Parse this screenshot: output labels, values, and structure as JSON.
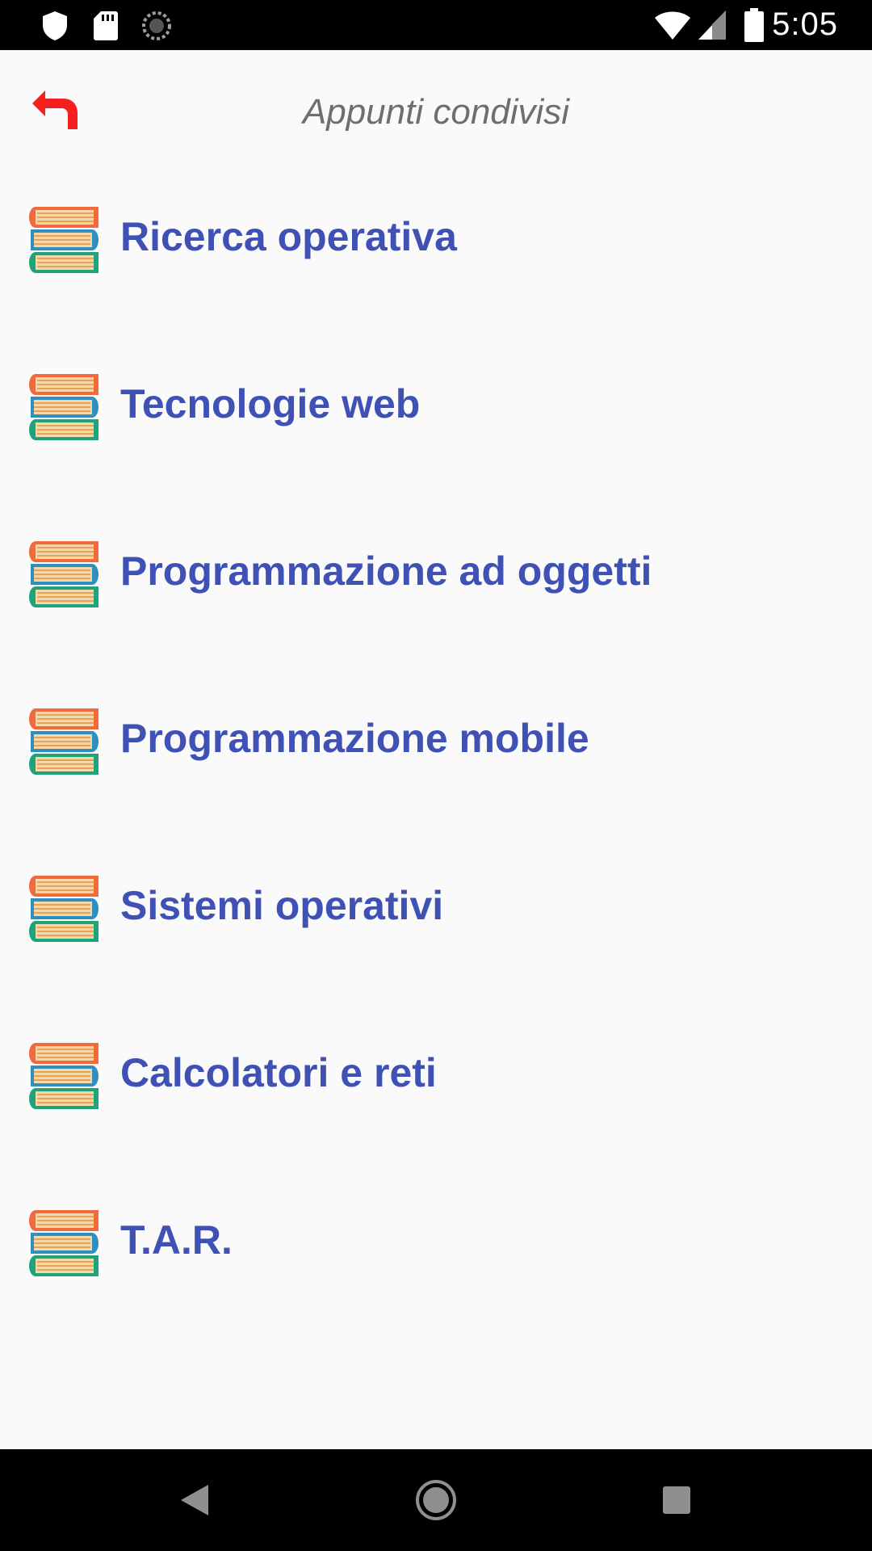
{
  "status_bar": {
    "time": "5:05",
    "left_icons": [
      "shield-icon",
      "sd-card-icon",
      "sync-icon"
    ],
    "right_icons": [
      "wifi-icon",
      "cell-signal-icon",
      "battery-icon"
    ]
  },
  "header": {
    "title": "Appunti condivisi",
    "back_icon": "back-arrow-icon",
    "back_color": "#f41f1f"
  },
  "colors": {
    "item_text": "#3f51b5",
    "title_text": "#6e6e6e",
    "background": "#fafafa"
  },
  "courses": [
    {
      "label": "Ricerca operativa",
      "icon": "books-icon"
    },
    {
      "label": "Tecnologie web",
      "icon": "books-icon"
    },
    {
      "label": "Programmazione ad oggetti",
      "icon": "books-icon"
    },
    {
      "label": "Programmazione mobile",
      "icon": "books-icon"
    },
    {
      "label": "Sistemi operativi",
      "icon": "books-icon"
    },
    {
      "label": "Calcolatori e reti",
      "icon": "books-icon"
    },
    {
      "label": "T.A.R.",
      "icon": "books-icon"
    }
  ],
  "nav_bar": {
    "buttons": [
      "back-triangle-icon",
      "home-circle-icon",
      "recents-square-icon"
    ]
  }
}
